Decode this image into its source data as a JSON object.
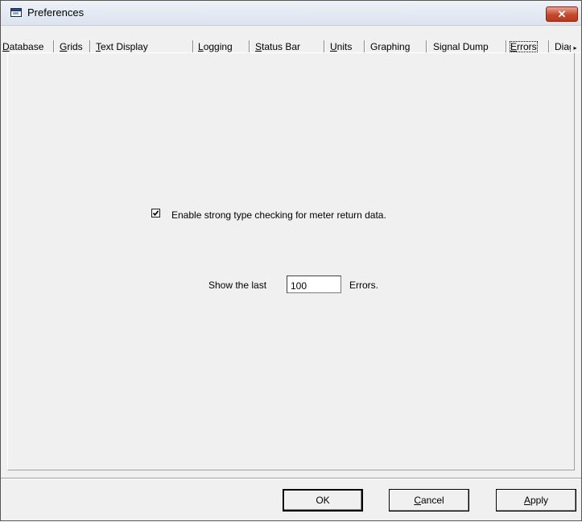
{
  "window": {
    "title": "Preferences"
  },
  "tabs": [
    {
      "label": "Database",
      "accel": "D",
      "rest": "atabase"
    },
    {
      "label": "Grids",
      "accel": "G",
      "rest": "rids"
    },
    {
      "label": "Text Display",
      "accel": "T",
      "rest": "ext Display"
    },
    {
      "label": "Logging",
      "accel": "L",
      "rest": "ogging"
    },
    {
      "label": "Status Bar",
      "accel": "S",
      "rest": "tatus Bar"
    },
    {
      "label": "Units",
      "accel": "U",
      "rest": "nits"
    },
    {
      "label": "Graphing",
      "accel": "",
      "rest": "Graphing"
    },
    {
      "label": "Signal Dump",
      "accel": "",
      "rest": "Signal Dump"
    },
    {
      "label": "Errors",
      "accel": "E",
      "rest": "rrors"
    },
    {
      "label": "Diag",
      "accel": "",
      "rest": "Diag"
    }
  ],
  "active_tab": "Errors",
  "errors_page": {
    "strong_type_checking": {
      "label": "Enable strong type checking for meter return data.",
      "checked": true
    },
    "show_last_label": "Show the last",
    "show_last_value": "100",
    "errors_suffix": "Errors."
  },
  "buttons": {
    "ok": "OK",
    "cancel_accel": "C",
    "cancel_rest": "ancel",
    "apply_accel": "A",
    "apply_rest": "pply"
  },
  "icons": {
    "window_icon": "window-icon",
    "close_icon": "close-icon",
    "scroll_right": "tab-scroll-right-icon",
    "check": "checkmark-icon"
  },
  "colors": {
    "dialog_bg": "#f0f0f0",
    "close_button": "#c7472a"
  }
}
